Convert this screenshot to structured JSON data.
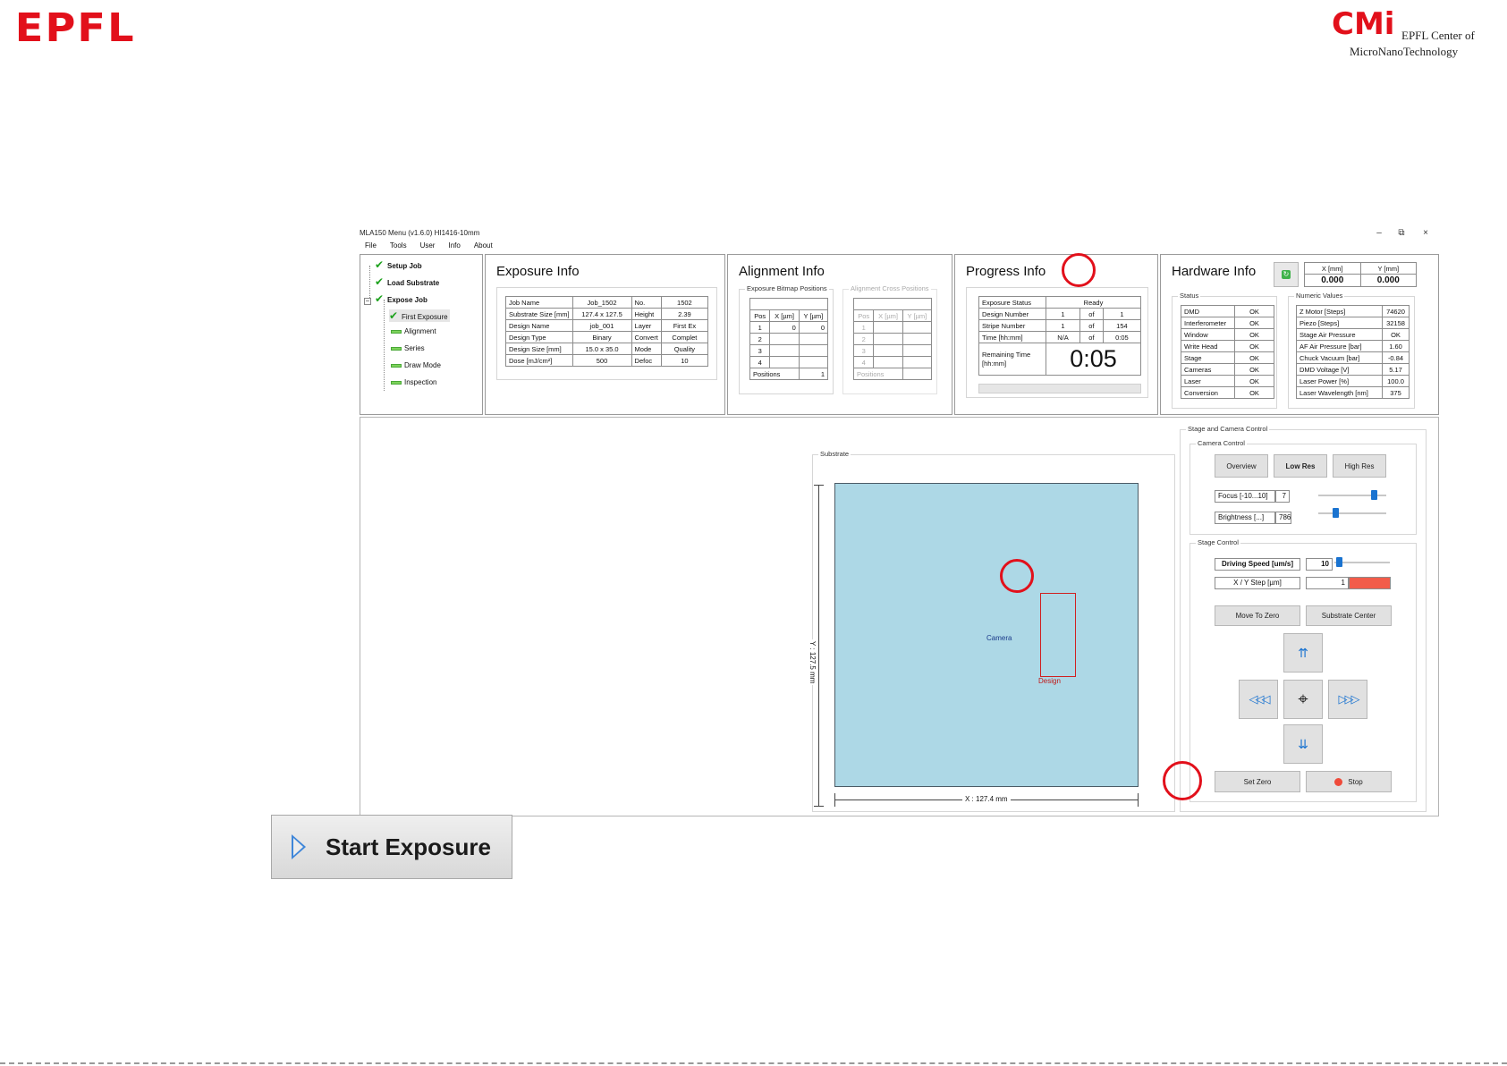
{
  "logos": {
    "epfl": "EPFL",
    "cmi": "CMi",
    "cmi_line1": "EPFL Center of",
    "cmi_line2": "MicroNanoTechnology"
  },
  "window": {
    "title": "MLA150 Menu (v1.6.0) HI1416-10mm",
    "controls": [
      "–",
      "⧉",
      "×"
    ]
  },
  "menu": [
    "File",
    "Tools",
    "User",
    "Info",
    "About"
  ],
  "tree": {
    "setup_job": "Setup Job",
    "load_substrate": "Load Substrate",
    "expose_job": "Expose Job",
    "first_exposure": "First Exposure",
    "alignment": "Alignment",
    "series": "Series",
    "draw_mode": "Draw Mode",
    "inspection": "Inspection"
  },
  "exposure_info": {
    "title": "Exposure Info",
    "rows": [
      [
        "Job Name",
        "Job_1502",
        "No.",
        "1502"
      ],
      [
        "Substrate Size [mm]",
        "127.4 x 127.5",
        "Height",
        "2.39"
      ],
      [
        "Design Name",
        "job_001",
        "Layer",
        "First Ex"
      ],
      [
        "Design Type",
        "Binary",
        "Convert",
        "Complet"
      ],
      [
        "Design Size [mm]",
        "15.0 x 35.0",
        "Mode",
        "Quality"
      ],
      [
        "Dose [mJ/cm²]",
        "500",
        "Defoc",
        "10"
      ]
    ]
  },
  "alignment_info": {
    "title": "Alignment Info",
    "bitmap_label": "Exposure Bitmap Positions",
    "cross_label": "Alignment Cross Positions",
    "headers": [
      "Pos",
      "X [µm]",
      "Y [µm]"
    ],
    "bitmap_rows": [
      [
        "1",
        "0",
        "0"
      ],
      [
        "2",
        "",
        ""
      ],
      [
        "3",
        "",
        ""
      ],
      [
        "4",
        "",
        ""
      ]
    ],
    "cross_rows": [
      [
        "1",
        "",
        ""
      ],
      [
        "2",
        "",
        ""
      ],
      [
        "3",
        "",
        ""
      ],
      [
        "4",
        "",
        ""
      ]
    ],
    "positions_label": "Positions",
    "positions_value": "1"
  },
  "progress_info": {
    "title": "Progress Info",
    "exposure_status_label": "Exposure Status",
    "exposure_status": "Ready",
    "rows": [
      [
        "Design Number",
        "1",
        "of",
        "1"
      ],
      [
        "Stripe Number",
        "1",
        "of",
        "154"
      ],
      [
        "Time [hh:mm]",
        "N/A",
        "of",
        "0:05"
      ]
    ],
    "remaining_label": "Remaining Time [hh:mm]",
    "remaining_value": "0:05",
    "progress": 0
  },
  "hardware_info": {
    "title": "Hardware Info",
    "x_label": "X [mm]",
    "y_label": "Y [mm]",
    "x_value": "0.000",
    "y_value": "0.000",
    "status_label": "Status",
    "status": [
      [
        "DMD",
        "OK"
      ],
      [
        "Interferometer",
        "OK"
      ],
      [
        "Window",
        "OK"
      ],
      [
        "Write Head",
        "OK"
      ],
      [
        "Stage",
        "OK"
      ],
      [
        "Cameras",
        "OK"
      ],
      [
        "Laser",
        "OK"
      ],
      [
        "Conversion",
        "OK"
      ]
    ],
    "numeric_label": "Numeric Values",
    "numeric": [
      [
        "Z Motor [Steps]",
        "74620"
      ],
      [
        "Piezo [Steps]",
        "32158"
      ],
      [
        "Stage Air Pressure",
        "OK"
      ],
      [
        "AF Air Pressure [bar]",
        "1.60"
      ],
      [
        "Chuck Vacuum [bar]",
        "-0.84"
      ],
      [
        "DMD Voltage [V]",
        "5.17"
      ],
      [
        "Laser Power [%]",
        "100.0"
      ],
      [
        "Laser Wavelength [nm]",
        "375"
      ]
    ]
  },
  "substrate": {
    "label": "Substrate",
    "y_dim": "Y : 127.5 mm",
    "x_dim": "X : 127.4 mm",
    "camera_label": "Camera",
    "design_label": "Design"
  },
  "stage_camera": {
    "title": "Stage and Camera Control",
    "camera_control": "Camera Control",
    "overview": "Overview",
    "low_res": "Low Res",
    "high_res": "High Res",
    "focus_label": "Focus [-10...10]",
    "focus_value": "7",
    "brightness_label": "Brightness [...]",
    "brightness_value": "786",
    "stage_control": "Stage Control",
    "driving_speed_label": "Driving Speed [um/s]",
    "driving_speed_value": "10",
    "xy_step_label": "X / Y Step [µm]",
    "xy_step_value": "1",
    "move_to_zero": "Move To Zero",
    "substrate_center": "Substrate Center",
    "set_zero": "Set Zero",
    "stop": "Stop"
  },
  "start_exposure": "Start Exposure",
  "colors": {
    "brand_red": "#e2101b",
    "substrate_blue": "#add8e6",
    "accent_blue": "#1a73d0",
    "ok_green": "#1ea21e",
    "step_bar": "#f25c4a"
  }
}
